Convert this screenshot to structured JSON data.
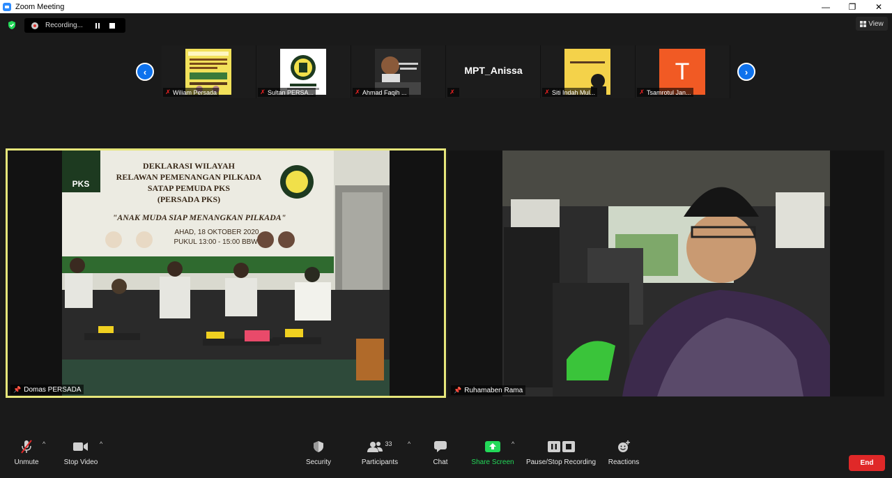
{
  "window": {
    "title": "Zoom Meeting",
    "minimize": "—",
    "restore": "❐",
    "close": "✕"
  },
  "recording": {
    "status": "Recording..."
  },
  "view_button": {
    "label": "View"
  },
  "gallery": {
    "participants": [
      {
        "name": "Wiliam Persada",
        "has_image": true
      },
      {
        "name": "Sultan PERSA...",
        "has_image": true
      },
      {
        "name": "Ahmad Faqih ...",
        "has_image": true
      },
      {
        "name": "",
        "display_name": "MPT_Anissa",
        "has_image": false
      },
      {
        "name": "Siti Indah Mul...",
        "has_image": true
      },
      {
        "name": "Tsamrotul Jan...",
        "has_image": true,
        "initial": "T"
      }
    ]
  },
  "main_videos": {
    "left": {
      "name": "Domas PERSADA",
      "banner": {
        "line1": "DEKLARASI WILAYAH",
        "line2": "RELAWAN PEMENANGAN PILKADA",
        "line3": "SATAP PEMUDA PKS",
        "line4": "(PERSADA PKS)",
        "slogan": "\"ANAK MUDA SIAP MENANGKAN PILKADA\"",
        "date": "AHAD, 18 OKTOBER 2020",
        "time": "PUKUL 13:00 - 15:00 BBWI",
        "logo": "PKS"
      }
    },
    "right": {
      "name": "Ruhamaben Rama"
    }
  },
  "toolbar": {
    "unmute": "Unmute",
    "stop_video": "Stop Video",
    "security": "Security",
    "participants": "Participants",
    "participants_count": "33",
    "chat": "Chat",
    "share_screen": "Share Screen",
    "pause_stop_recording": "Pause/Stop Recording",
    "reactions": "Reactions",
    "end": "End"
  },
  "colors": {
    "accent_blue": "#0e72ed",
    "active_speaker_border": "#e6e67a",
    "share_green": "#23d959",
    "end_red": "#e02828"
  }
}
